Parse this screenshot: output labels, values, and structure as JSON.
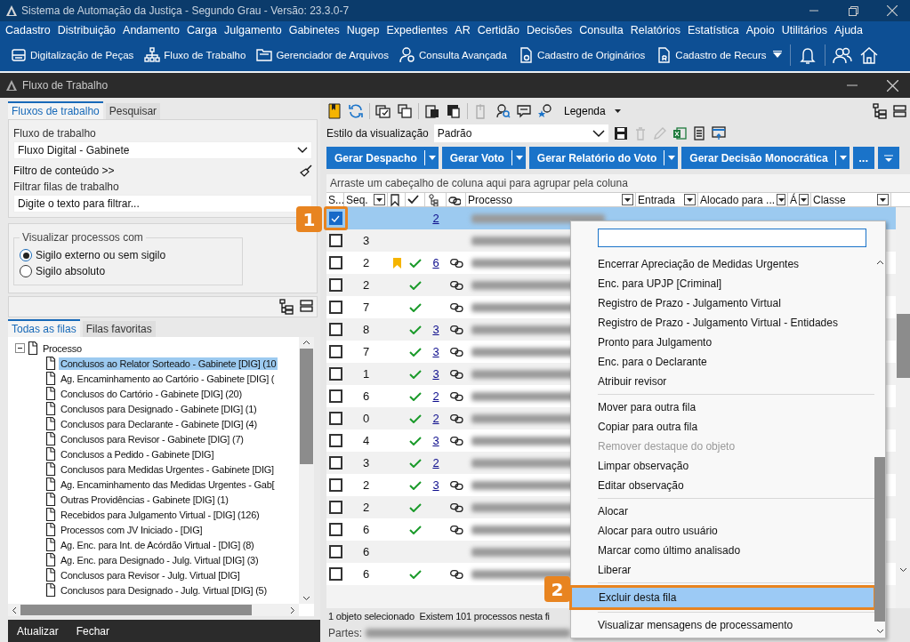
{
  "window": {
    "title": "Sistema de Automação da Justiça - Segundo Grau - Versão: 23.3.0-7"
  },
  "menubar": [
    "Cadastro",
    "Distribuição",
    "Andamento",
    "Carga",
    "Julgamento",
    "Gabinetes",
    "Nugep",
    "Expedientes",
    "AR",
    "Certidão",
    "Decisões",
    "Consulta",
    "Relatórios",
    "Estatística",
    "Apoio",
    "Utilitários",
    "Ajuda"
  ],
  "toolbar": [
    {
      "label": "Digitalização de Peças",
      "kind": "scanner"
    },
    {
      "label": "Fluxo de Trabalho",
      "kind": "flow"
    },
    {
      "label": "Gerenciador de Arquivos",
      "kind": "folder"
    },
    {
      "label": "Consulta Avançada",
      "kind": "person"
    },
    {
      "label": "Cadastro de Originários",
      "kind": "doc"
    },
    {
      "label": "Cadastro de Recurs",
      "kind": "docr"
    }
  ],
  "child_window": {
    "title": "Fluxo de Trabalho"
  },
  "left": {
    "tabs": [
      {
        "label": "Fluxos de trabalho",
        "selected": true
      },
      {
        "label": "Pesquisar",
        "selected": false
      }
    ],
    "workflow": {
      "label": "Fluxo de trabalho",
      "value": "Fluxo Digital - Gabinete"
    },
    "content_filter": "Filtro de conteúdo >>",
    "queue_filter": {
      "label": "Filtrar filas de trabalho",
      "placeholder": "Digite o texto para filtrar..."
    },
    "visibility": {
      "legend": "Visualizar processos com",
      "options": [
        {
          "label": "Sigilo externo ou sem sigilo",
          "selected": true
        },
        {
          "label": "Sigilo absoluto",
          "selected": false
        }
      ]
    },
    "queue_tabs": [
      {
        "label": "Todas as filas",
        "selected": true
      },
      {
        "label": "Filas favoritas",
        "selected": false
      }
    ],
    "tree": [
      {
        "label": "Processo",
        "expanded": true,
        "children": [
          {
            "label": "Conclusos ao Relator Sorteado - Gabinete [DIG] (10",
            "selected": true
          },
          {
            "label": "Ag. Encaminhamento ao Cartório - Gabinete [DIG] (",
            "selected": false
          },
          {
            "label": "Conclusos do Cartório - Gabinete [DIG] (20)",
            "selected": false
          },
          {
            "label": "Conclusos para Designado - Gabinete [DIG] (1)",
            "selected": false
          },
          {
            "label": "Conclusos para Declarante - Gabinete [DIG] (4)",
            "selected": false
          },
          {
            "label": "Conclusos para Revisor - Gabinete [DIG] (7)",
            "selected": false
          },
          {
            "label": "Conclusos a Pedido - Gabinete [DIG]",
            "selected": false
          },
          {
            "label": "Conclusos para Medidas Urgentes - Gabinete [DIG]",
            "selected": false
          },
          {
            "label": "Ag. Encaminhamento das Medidas Urgentes - Gab[",
            "selected": false
          },
          {
            "label": "Outras Providências - Gabinete [DIG] (1)",
            "selected": false
          },
          {
            "label": "Recebidos para Julgamento Virtual - [DIG] (126)",
            "selected": false
          },
          {
            "label": "Processos com JV Iniciado - [DIG]",
            "selected": false
          },
          {
            "label": "Ag. Enc. para Int. de Acórdão Virtual - [DIG] (8)",
            "selected": false
          },
          {
            "label": "Ag. Enc. para Designado - Julg. Virtual [DIG] (3)",
            "selected": false
          },
          {
            "label": "Conclusos para Revisor - Julg. Virtual [DIG]",
            "selected": false
          },
          {
            "label": "Conclusos para Designado - Julg. Virtual [DIG] (5)",
            "selected": false
          }
        ]
      }
    ],
    "buttons": [
      "Atualizar",
      "Fechar"
    ]
  },
  "right": {
    "legend_menu": "Legenda",
    "view_style": {
      "label": "Estilo da visualização",
      "value": "Padrão"
    },
    "actions": [
      "Gerar Despacho",
      "Gerar Voto",
      "Gerar Relatório do Voto",
      "Gerar Decisão Monocrática"
    ],
    "more_button": "...",
    "group_hint": "Arraste um cabeçalho de coluna aqui para agrupar pela coluna",
    "columns": [
      {
        "label": "S...",
        "kind": "text",
        "filter": false
      },
      {
        "label": "Seq.",
        "kind": "text",
        "filter": true
      },
      {
        "kind": "bookmark",
        "filter": false
      },
      {
        "kind": "check",
        "filter": false
      },
      {
        "kind": "tree",
        "filter": false
      },
      {
        "kind": "link",
        "filter": false
      },
      {
        "label": "Processo",
        "kind": "text",
        "filter": true
      },
      {
        "label": "Entrada",
        "kind": "text",
        "filter": true
      },
      {
        "label": "Alocado para ...",
        "kind": "text",
        "filter": true
      },
      {
        "label": "Á",
        "kind": "text",
        "filter": true
      },
      {
        "label": "Classe",
        "kind": "text",
        "filter": true
      }
    ],
    "rows": [
      {
        "checked": true,
        "selected": true,
        "seq": "",
        "bookmark": false,
        "done": false,
        "count": "2",
        "linked": false
      },
      {
        "checked": false,
        "selected": false,
        "seq": "3",
        "bookmark": false,
        "done": false,
        "count": "",
        "linked": false
      },
      {
        "checked": false,
        "selected": false,
        "seq": "2",
        "bookmark": true,
        "done": true,
        "count": "6",
        "linked": true
      },
      {
        "checked": false,
        "selected": false,
        "seq": "2",
        "bookmark": false,
        "done": true,
        "count": "",
        "linked": true
      },
      {
        "checked": false,
        "selected": false,
        "seq": "7",
        "bookmark": false,
        "done": true,
        "count": "",
        "linked": true
      },
      {
        "checked": false,
        "selected": false,
        "seq": "8",
        "bookmark": false,
        "done": true,
        "count": "3",
        "linked": true
      },
      {
        "checked": false,
        "selected": false,
        "seq": "7",
        "bookmark": false,
        "done": true,
        "count": "3",
        "linked": true
      },
      {
        "checked": false,
        "selected": false,
        "seq": "1",
        "bookmark": false,
        "done": true,
        "count": "3",
        "linked": true
      },
      {
        "checked": false,
        "selected": false,
        "seq": "6",
        "bookmark": false,
        "done": true,
        "count": "2",
        "linked": true
      },
      {
        "checked": false,
        "selected": false,
        "seq": "0",
        "bookmark": false,
        "done": true,
        "count": "2",
        "linked": true
      },
      {
        "checked": false,
        "selected": false,
        "seq": "4",
        "bookmark": false,
        "done": true,
        "count": "3",
        "linked": true
      },
      {
        "checked": false,
        "selected": false,
        "seq": "3",
        "bookmark": false,
        "done": true,
        "count": "2",
        "linked": false
      },
      {
        "checked": false,
        "selected": false,
        "seq": "2",
        "bookmark": false,
        "done": true,
        "count": "3",
        "linked": true
      },
      {
        "checked": false,
        "selected": false,
        "seq": "2",
        "bookmark": false,
        "done": true,
        "count": "",
        "linked": true
      },
      {
        "checked": false,
        "selected": false,
        "seq": "6",
        "bookmark": false,
        "done": true,
        "count": "",
        "linked": true
      },
      {
        "checked": false,
        "selected": false,
        "seq": "6",
        "bookmark": false,
        "done": false,
        "count": "",
        "linked": false
      },
      {
        "checked": false,
        "selected": false,
        "seq": "6",
        "bookmark": false,
        "done": true,
        "count": "",
        "linked": true
      }
    ],
    "status": "1 objeto selecionado  Existem 101 processos nesta fi",
    "parties_label": "Partes:"
  },
  "context_menu": {
    "items": [
      {
        "kind": "item",
        "label": "Encerrar Apreciação de Medidas Urgentes",
        "disabled": false,
        "selected": false
      },
      {
        "kind": "item",
        "label": "Enc. para UPJP [Criminal]",
        "disabled": false,
        "selected": false
      },
      {
        "kind": "item",
        "label": "Registro de Prazo - Julgamento Virtual",
        "disabled": false,
        "selected": false
      },
      {
        "kind": "item",
        "label": "Registro de Prazo - Julgamento Virtual - Entidades",
        "disabled": false,
        "selected": false
      },
      {
        "kind": "item",
        "label": "Pronto para Julgamento",
        "disabled": false,
        "selected": false
      },
      {
        "kind": "item",
        "label": "Enc. para o Declarante",
        "disabled": false,
        "selected": false
      },
      {
        "kind": "item",
        "label": "Atribuir revisor",
        "disabled": false,
        "selected": false
      },
      {
        "kind": "separator"
      },
      {
        "kind": "item",
        "label": "Mover para outra fila",
        "disabled": false,
        "selected": false
      },
      {
        "kind": "item",
        "label": "Copiar para outra fila",
        "disabled": false,
        "selected": false
      },
      {
        "kind": "item",
        "label": "Remover destaque do objeto",
        "disabled": true,
        "selected": false
      },
      {
        "kind": "item",
        "label": "Limpar observação",
        "disabled": false,
        "selected": false
      },
      {
        "kind": "item",
        "label": "Editar observação",
        "disabled": false,
        "selected": false
      },
      {
        "kind": "separator"
      },
      {
        "kind": "item",
        "label": "Alocar",
        "disabled": false,
        "selected": false
      },
      {
        "kind": "item",
        "label": "Alocar para outro usuário",
        "disabled": false,
        "selected": false
      },
      {
        "kind": "item",
        "label": "Marcar como último analisado",
        "disabled": false,
        "selected": false
      },
      {
        "kind": "item",
        "label": "Liberar",
        "disabled": false,
        "selected": false
      },
      {
        "kind": "separator"
      },
      {
        "kind": "item",
        "label": "Excluir desta fila",
        "disabled": false,
        "selected": true
      },
      {
        "kind": "separator"
      },
      {
        "kind": "item",
        "label": "Visualizar mensagens de processamento",
        "disabled": false,
        "selected": false
      }
    ]
  },
  "callouts": [
    "1",
    "2"
  ]
}
